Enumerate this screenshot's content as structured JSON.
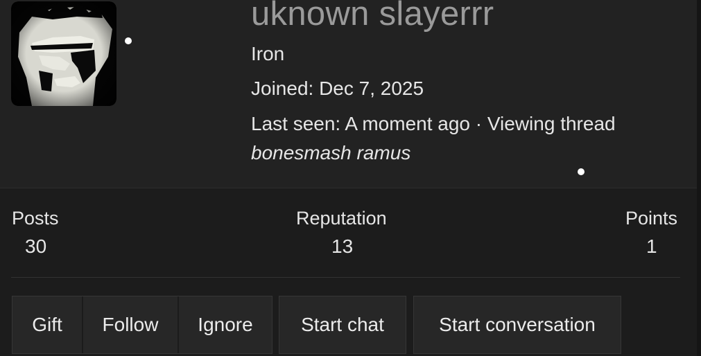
{
  "profile": {
    "username": "uknown slayerrr",
    "user_title": "Iron",
    "joined": "Joined: Dec 7, 2025",
    "last_seen": "Last seen: A moment ago · Viewing thread",
    "thread_title": "bonesmash ramus"
  },
  "stats": {
    "posts_label": "Posts",
    "posts_value": "30",
    "reputation_label": "Reputation",
    "reputation_value": "13",
    "points_label": "Points",
    "points_value": "1"
  },
  "actions": {
    "gift": "Gift",
    "follow": "Follow",
    "ignore": "Ignore",
    "start_chat": "Start chat",
    "start_conversation": "Start conversation"
  },
  "colors": {
    "background": "#1c1c1c",
    "header_background": "#222222",
    "username": "#9a9a9a",
    "text": "#e6e6e6"
  }
}
